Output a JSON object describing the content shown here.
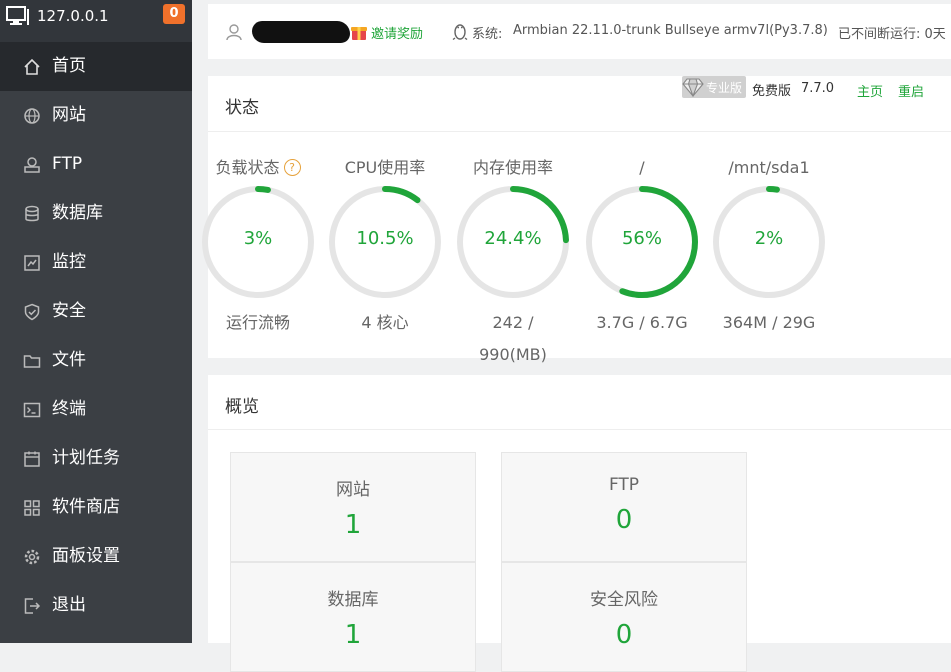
{
  "sidebar": {
    "host": "127.0.0.1",
    "badge": "0",
    "items": [
      {
        "label": "首页",
        "icon": "home-icon",
        "active": true
      },
      {
        "label": "网站",
        "icon": "globe-icon"
      },
      {
        "label": "FTP",
        "icon": "ftp-icon"
      },
      {
        "label": "数据库",
        "icon": "database-icon"
      },
      {
        "label": "监控",
        "icon": "monitor-icon"
      },
      {
        "label": "安全",
        "icon": "shield-icon"
      },
      {
        "label": "文件",
        "icon": "folder-icon"
      },
      {
        "label": "终端",
        "icon": "terminal-icon"
      },
      {
        "label": "计划任务",
        "icon": "calendar-icon"
      },
      {
        "label": "软件商店",
        "icon": "apps-icon"
      },
      {
        "label": "面板设置",
        "icon": "gear-icon"
      },
      {
        "label": "退出",
        "icon": "logout-icon"
      }
    ]
  },
  "topbar": {
    "invite": "邀请奖励",
    "system_label": "系统:",
    "system_value": "Armbian 22.11.0-trunk Bullseye armv7l(Py3.7.8)",
    "uptime": "已不间断运行: 0天"
  },
  "status": {
    "title": "状态",
    "pro_label": "专业版",
    "free_label": "免费版",
    "version": "7.7.0",
    "home_link": "主页",
    "restart_link": "重启",
    "gauges": [
      {
        "label": "负载状态",
        "percent_text": "3%",
        "value": 3,
        "sub": "运行流畅",
        "help": "?"
      },
      {
        "label": "CPU使用率",
        "percent_text": "10.5%",
        "value": 10.5,
        "sub": "4 核心"
      },
      {
        "label": "内存使用率",
        "percent_text": "24.4%",
        "value": 24.4,
        "sub": "242 / 990(MB)"
      },
      {
        "label": "/",
        "percent_text": "56%",
        "value": 56,
        "sub": "3.7G / 6.7G"
      },
      {
        "label": "/mnt/sda1",
        "percent_text": "2%",
        "value": 2,
        "sub": "364M / 29G"
      }
    ]
  },
  "overview": {
    "title": "概览",
    "tiles": [
      {
        "label": "网站",
        "value": "1"
      },
      {
        "label": "FTP",
        "value": "0"
      },
      {
        "label": "数据库",
        "value": "1"
      },
      {
        "label": "安全风险",
        "value": "0"
      }
    ]
  },
  "colors": {
    "accent": "#20a53a",
    "sidebar": "#3b3f44",
    "badge": "#f0712b"
  }
}
